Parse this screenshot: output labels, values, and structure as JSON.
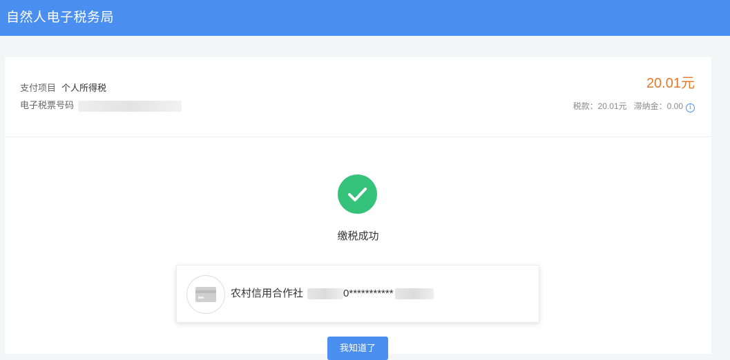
{
  "app": {
    "title": "自然人电子税务局"
  },
  "payment": {
    "item_label": "支付项目",
    "item_value": "个人所得税",
    "ticket_label": "电子税票号码",
    "amount": "20.01元",
    "tax_label": "税款：",
    "tax_value": "20.01元",
    "late_fee_label": "滞纳金：",
    "late_fee_value": "0.00"
  },
  "result": {
    "status": "缴税成功"
  },
  "bank": {
    "name": "农村信用合作社",
    "masked_digits": "0***********"
  },
  "actions": {
    "primary_label": "我知道了"
  },
  "colors": {
    "header": "#4a8ff0",
    "amount": "#e8782a",
    "success": "#35c27a"
  },
  "icons": [
    "info-icon",
    "checkmark-icon",
    "bank-card-icon"
  ]
}
